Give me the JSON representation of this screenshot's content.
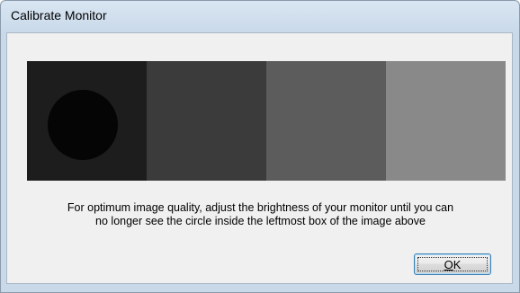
{
  "window": {
    "title": "Calibrate Monitor"
  },
  "calibration": {
    "swatch_colors": [
      "#1d1d1d",
      "#3b3b3b",
      "#5c5c5c",
      "#898989"
    ],
    "circle_color": "#050505",
    "instructions_line1": "For optimum image quality, adjust the brightness of your monitor until you can",
    "instructions_line2": "no longer see the circle inside the leftmost box of the image above"
  },
  "buttons": {
    "ok_mnemonic": "O",
    "ok_rest": "K"
  }
}
